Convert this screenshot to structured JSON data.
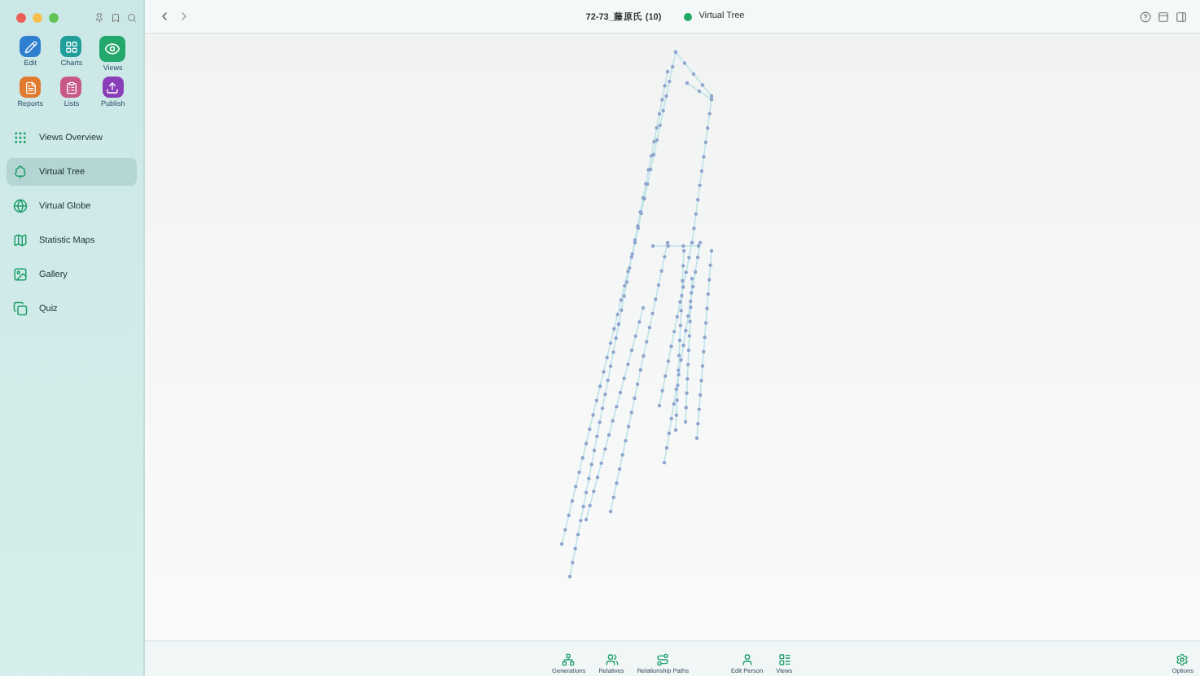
{
  "sidebar": {
    "tools": [
      {
        "label": "Edit",
        "kind": "edit",
        "color": "#2f7fd0",
        "selected": false
      },
      {
        "label": "Charts",
        "kind": "charts",
        "color": "#1f9e9a",
        "selected": false
      },
      {
        "label": "Views",
        "kind": "views",
        "color": "#23a86b",
        "selected": true
      },
      {
        "label": "Reports",
        "kind": "reports",
        "color": "#e07a2e",
        "selected": false
      },
      {
        "label": "Lists",
        "kind": "lists",
        "color": "#c8578a",
        "selected": false
      },
      {
        "label": "Publish",
        "kind": "publish",
        "color": "#8a3fb8",
        "selected": false
      }
    ],
    "items": [
      {
        "label": "Views Overview",
        "kind": "overview",
        "selected": false
      },
      {
        "label": "Virtual Tree",
        "kind": "tree",
        "selected": true
      },
      {
        "label": "Virtual Globe",
        "kind": "globe",
        "selected": false
      },
      {
        "label": "Statistic Maps",
        "kind": "maps",
        "selected": false
      },
      {
        "label": "Gallery",
        "kind": "gallery",
        "selected": false
      },
      {
        "label": "Quiz",
        "kind": "quiz",
        "selected": false
      }
    ]
  },
  "header": {
    "file": "72-73_藤原氏 (10)",
    "view": "Virtual Tree"
  },
  "toolbar": [
    {
      "label": "Generations",
      "kind": "generations"
    },
    {
      "label": "Relatives",
      "kind": "relatives"
    },
    {
      "label": "Relationship Paths",
      "kind": "paths"
    },
    {
      "label": "Edit Person",
      "kind": "person"
    },
    {
      "label": "Views",
      "kind": "views"
    },
    {
      "label": "Options",
      "kind": "options"
    }
  ]
}
